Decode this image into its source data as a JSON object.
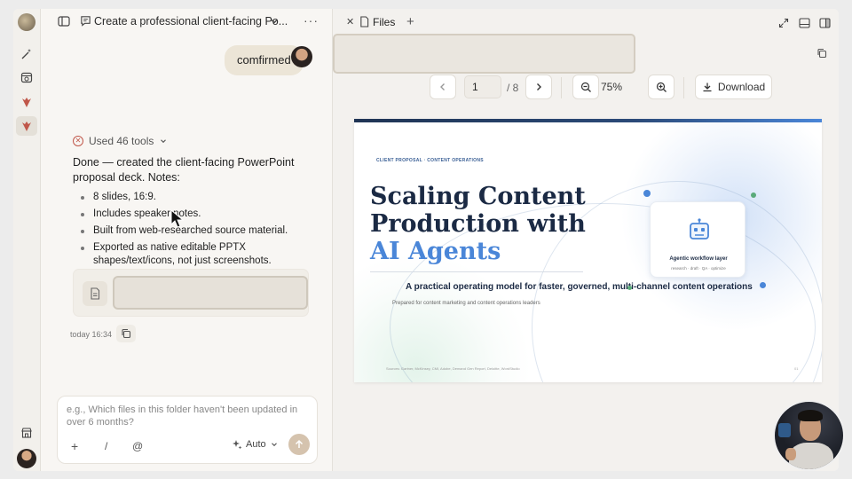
{
  "chat": {
    "title": "Create a professional client-facing Po...",
    "user_message": "comfirmed",
    "tools_summary": "Used 46 tools",
    "reply_intro": "Done — created the client-facing PowerPoint proposal deck. Notes:",
    "notes": [
      "8 slides, 16:9.",
      "Includes speaker notes.",
      "Built from web-researched source material.",
      "Exported as native editable PPTX shapes/text/icons, not just screenshots."
    ],
    "timestamp": "today 16:34",
    "composer_placeholder": "e.g., Which files in this folder haven't been updated in over 6 months?",
    "mode_label": "Auto",
    "slash_label": "/",
    "at_label": "@",
    "plus_label": "+"
  },
  "files": {
    "tab_label": "Files",
    "page_current": "1",
    "page_total": "/ 8",
    "zoom": "75%",
    "download_label": "Download"
  },
  "slide": {
    "kicker": "CLIENT PROPOSAL · CONTENT OPERATIONS",
    "title_line1": "Scaling Content",
    "title_line2": "Production with",
    "title_accent": "AI Agents",
    "subtitle": "A practical operating model for faster, governed, multi-channel content operations",
    "prepared_for": "Prepared for content marketing and content operations leaders",
    "sources": "Sources: Gartner, McKinsey, CMI, Adobe, Demand Gen Report, Deloitte, WordStudio",
    "page_number": "01",
    "card_title": "Agentic workflow layer",
    "card_sub": "research · draft · QA · optimize"
  },
  "colors": {
    "accent_blue": "#4a86d8",
    "navy": "#1b2a44",
    "bubble": "#ece5d7",
    "send_button": "#d5c3ae",
    "error_red": "#c0574a"
  },
  "icons": [
    "magic-wand-icon",
    "calendar-clock-icon",
    "app-icon",
    "store-icon",
    "sidebar-toggle-icon",
    "chat-icon",
    "chevron-down-icon",
    "more-icon",
    "close-icon",
    "file-icon",
    "plus-icon",
    "expand-icon",
    "layout-bottom-icon",
    "layout-right-icon",
    "copy-icon",
    "chevron-left-icon",
    "chevron-right-icon",
    "zoom-out-icon",
    "zoom-in-icon",
    "download-icon",
    "sparkle-icon",
    "arrow-up-icon",
    "robot-icon",
    "x-circle-icon",
    "document-icon"
  ]
}
